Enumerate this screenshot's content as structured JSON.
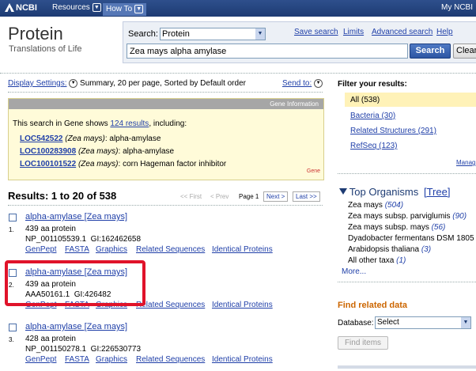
{
  "topbar": {
    "logo": "NCBI",
    "resources": "Resources",
    "howto": "How To",
    "mynobi": "My NCBI"
  },
  "header": {
    "db_title": "Protein",
    "db_subtitle": "Translations of Life"
  },
  "search": {
    "label": "Search:",
    "db_selected": "Protein",
    "query": "Zea mays alpha amylase",
    "search_button": "Search",
    "clear_button": "Clear",
    "links": [
      "Save search",
      "Limits",
      "Advanced search",
      "Help"
    ]
  },
  "display": {
    "settings_label": "Display Settings:",
    "settings_value": "Summary, 20 per page, Sorted by Default order",
    "send_to": "Send to:"
  },
  "gene_box": {
    "header": "Gene Information",
    "intro_pre": "This search in Gene shows ",
    "intro_link": "124 results",
    "intro_post": ", including:",
    "items": [
      {
        "id": "LOC542522",
        "species": "(Zea mays)",
        "desc": ": alpha-amylase"
      },
      {
        "id": "LOC100283908",
        "species": "(Zea mays)",
        "desc": ": alpha-amylase"
      },
      {
        "id": "LOC100101522",
        "species": "(Zea mays)",
        "desc": ": corn Hageman factor inhibitor"
      }
    ],
    "footer": "Gene"
  },
  "results": {
    "heading": "Results: 1 to 20 of 538",
    "pager": {
      "first": "<< First",
      "prev": "< Prev",
      "page": "Page 1",
      "next": "Next >",
      "last": "Last >>"
    },
    "items": [
      {
        "num": "1.",
        "title": "alpha-amylase [Zea mays]",
        "desc": "439 aa protein",
        "acc": "NP_001105539.1  GI:162462658",
        "links": [
          "GenPept",
          "FASTA",
          "Graphics",
          "Related Sequences",
          "Identical Proteins"
        ]
      },
      {
        "num": "2.",
        "title": "alpha-amylase [Zea mays]",
        "desc": "439 aa protein",
        "acc": "AAA50161.1  GI:426482",
        "links": [
          "GenPept",
          "FASTA",
          "Graphics",
          "Related Sequences",
          "Identical Proteins"
        ]
      },
      {
        "num": "3.",
        "title": "alpha-amylase [Zea mays]",
        "desc": "428 aa protein",
        "acc": "NP_001150278.1  GI:226530773",
        "links": [
          "GenPept",
          "FASTA",
          "Graphics",
          "Related Sequences",
          "Identical Proteins"
        ]
      }
    ]
  },
  "filter": {
    "heading": "Filter your results:",
    "items": [
      "All (538)",
      "Bacteria (30)",
      "Related Structures (291)",
      "RefSeq (123)"
    ],
    "manage": "Manag"
  },
  "organisms": {
    "heading": "Top Organisms",
    "tree": "[Tree]",
    "items": [
      {
        "name": "Zea mays",
        "count": "(504)"
      },
      {
        "name": "Zea mays subsp. parviglumis",
        "count": "(90)"
      },
      {
        "name": "Zea mays subsp. mays",
        "count": "(56)"
      },
      {
        "name": "Dyadobacter fermentans DSM 1805",
        "count": ""
      },
      {
        "name": "Arabidopsis thaliana",
        "count": "(3)"
      },
      {
        "name": "All other taxa",
        "count": "(1)"
      }
    ],
    "more": "More..."
  },
  "related": {
    "heading": "Find related data",
    "db_label": "Database:",
    "db_selected": "Select",
    "find_button": "Find items"
  },
  "colors": {
    "ncbi_blue": "#1d3b73",
    "link": "#1f3fa8",
    "highlight": "#e0132a",
    "gene_bg": "#fffbd9",
    "orange_head": "#cc6600"
  }
}
